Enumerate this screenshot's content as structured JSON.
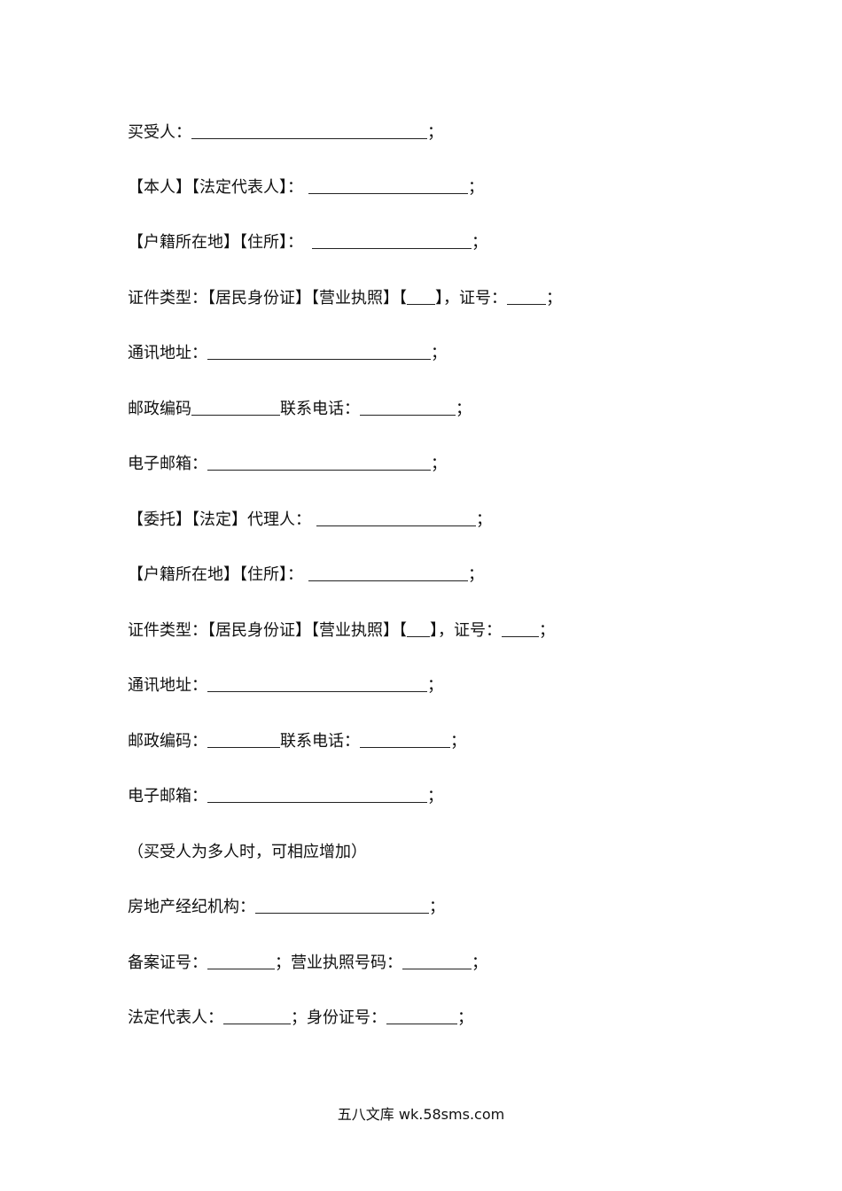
{
  "document": {
    "lines": [
      {
        "label": "买受人：",
        "suffix": "；"
      },
      {
        "label": "【本人】【法定代表人】：",
        "suffix": "；"
      },
      {
        "label": "【户籍所在地】【住所】：",
        "suffix": "；"
      },
      {
        "label": "证件类型：【居民身份证】【营业执照】【",
        "mid": "】，证号：",
        "suffix": "；"
      },
      {
        "label": "通讯地址：",
        "suffix": "；"
      },
      {
        "label": "邮政编码",
        "mid": "联系电话：",
        "suffix": "；"
      },
      {
        "label": "电子邮箱：",
        "suffix": "；"
      },
      {
        "label": "【委托】【法定】代理人：",
        "suffix": "；"
      },
      {
        "label": "【户籍所在地】【住所】：",
        "suffix": "；"
      },
      {
        "label": "证件类型：【居民身份证】【营业执照】【",
        "mid": "】，证号：",
        "suffix": "；"
      },
      {
        "label": "通讯地址：",
        "suffix": "；"
      },
      {
        "label": "邮政编码：",
        "mid": "联系电话：",
        "suffix": "；"
      },
      {
        "label": "电子邮箱：",
        "suffix": "；"
      },
      {
        "label": "（买受人为多人时，可相应增加）"
      },
      {
        "label": "房地产经纪机构：",
        "suffix": "；"
      },
      {
        "label": "备案证号：",
        "mid": "；营业执照号码：",
        "suffix": "；"
      },
      {
        "label": "法定代表人：",
        "mid": "；身份证号：",
        "suffix": "；"
      }
    ]
  },
  "footer": {
    "text": "五八文库 wk.58sms.com"
  }
}
